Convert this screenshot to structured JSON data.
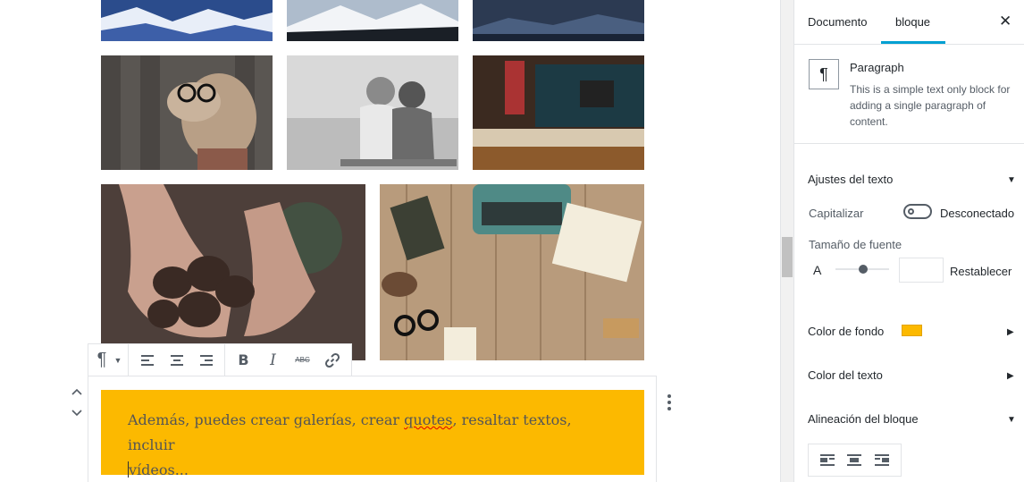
{
  "editor": {
    "images": [
      {
        "name": "snowy-mountain-image-1"
      },
      {
        "name": "mountain-range-image"
      },
      {
        "name": "night-mountain-image"
      },
      {
        "name": "dog-with-glasses-image"
      },
      {
        "name": "children-on-swing-image"
      },
      {
        "name": "coffee-shop-image"
      },
      {
        "name": "pinecones-in-hands-image"
      },
      {
        "name": "typewriter-desk-image"
      }
    ],
    "paragraph": {
      "text_before": "Además, puedes crear galerías, crear ",
      "misspelled_word": "quotes",
      "text_after": ", resaltar textos, incluir",
      "text_line2": "vídeos...",
      "background_color": "#fcb900"
    },
    "toolbar": {
      "icons": [
        "paragraph-icon",
        "chevron-down-icon",
        "align-left-icon",
        "align-center-icon",
        "align-right-icon",
        "bold-icon",
        "italic-icon",
        "strikethrough-icon",
        "link-icon"
      ]
    }
  },
  "sidebar": {
    "tabs": [
      {
        "label": "Documento",
        "active": false
      },
      {
        "label": "bloque",
        "active": true
      }
    ],
    "block_card": {
      "title": "Paragraph",
      "description": "This is a simple text only block for adding a single paragraph of content."
    },
    "text_settings": {
      "title": "Ajustes del texto",
      "capitalize_label": "Capitalizar",
      "capitalize_state": "Desconectado",
      "font_size_label": "Tamaño de fuente",
      "font_size_icon_letter": "A",
      "reset_label": "Restablecer",
      "font_size_input_value": ""
    },
    "background_color": {
      "title": "Color de fondo",
      "swatch": "#fcb900"
    },
    "text_color": {
      "title": "Color del texto"
    },
    "block_alignment": {
      "title": "Alineación del bloque"
    }
  }
}
